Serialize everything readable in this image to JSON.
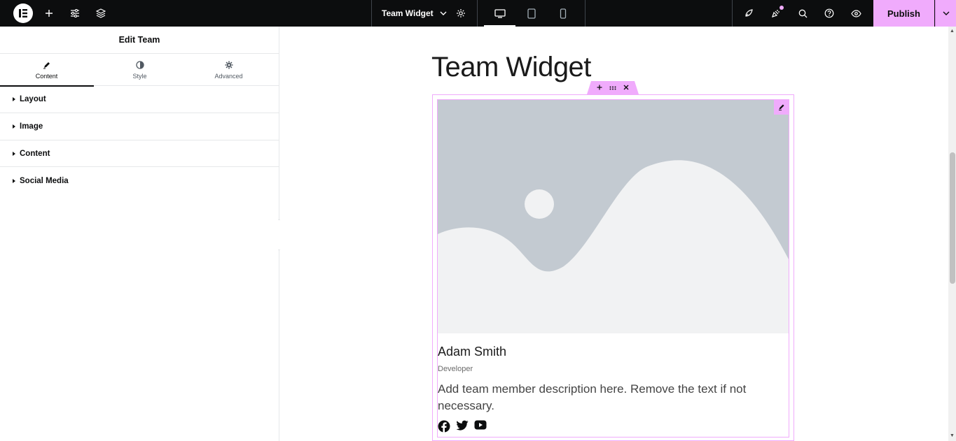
{
  "topbar": {
    "document_title": "Team Widget",
    "publish_label": "Publish",
    "colors": {
      "bar": "#0c0d0e",
      "accent": "#f0abfc"
    },
    "icons": [
      "elementor-logo-icon",
      "add-element-icon",
      "site-settings-icon",
      "structure-icon",
      "chevron-down-icon",
      "page-settings-icon",
      "desktop-icon",
      "tablet-icon",
      "mobile-icon",
      "launchpad-icon",
      "whats-new-icon",
      "search-icon",
      "help-icon",
      "preview-icon"
    ]
  },
  "panel": {
    "title": "Edit Team",
    "tabs": [
      {
        "label": "Content",
        "icon": "pencil-icon",
        "active": true
      },
      {
        "label": "Style",
        "icon": "half-circle-icon",
        "active": false
      },
      {
        "label": "Advanced",
        "icon": "gear-icon",
        "active": false
      }
    ],
    "sections": [
      {
        "label": "Layout"
      },
      {
        "label": "Image"
      },
      {
        "label": "Content"
      },
      {
        "label": "Social Media"
      }
    ]
  },
  "canvas": {
    "page_title": "Team Widget",
    "team_member": {
      "name": "Adam Smith",
      "role": "Developer",
      "description": "Add team member description here. Remove the text if not necessary.",
      "socials": [
        "facebook-icon",
        "twitter-icon",
        "youtube-icon"
      ]
    }
  }
}
